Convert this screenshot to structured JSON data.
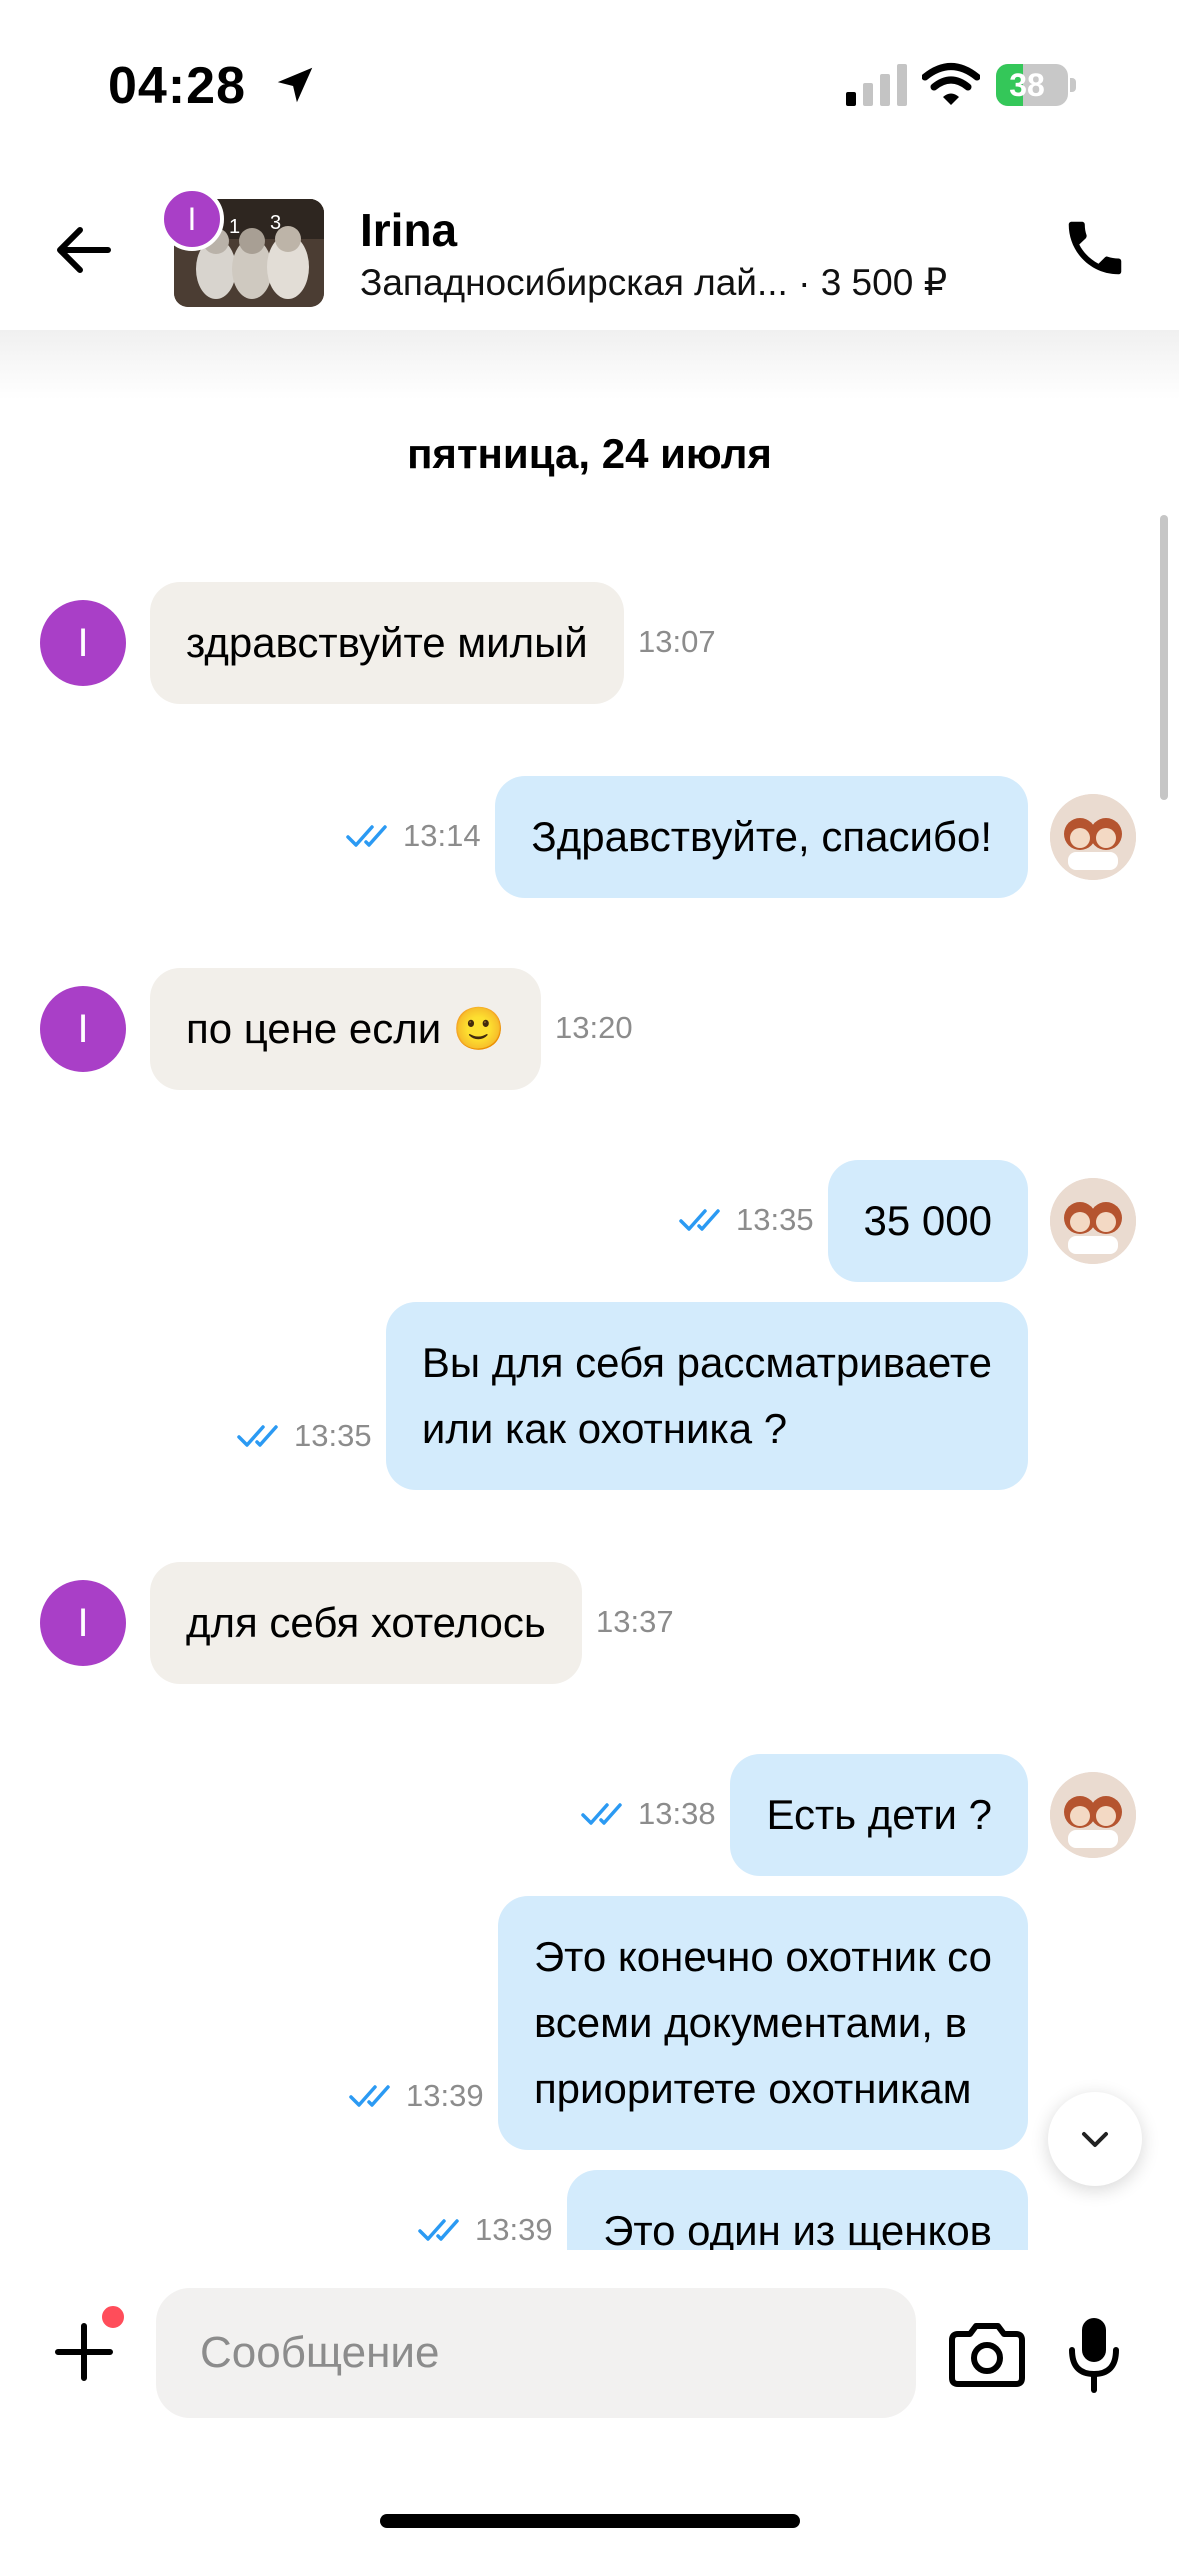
{
  "status_bar": {
    "time": "04:28",
    "battery": "38",
    "battery_level": 0.38,
    "icons": [
      "location-arrow-icon",
      "cellular-signal-icon",
      "wifi-icon",
      "battery-charging-icon"
    ]
  },
  "header": {
    "contact_name": "Irina",
    "avatar_letter": "I",
    "listing_title": "Западносибирская лай...",
    "listing_price": " · 3 500 ₽",
    "icons": [
      "back-arrow-icon",
      "phone-icon"
    ],
    "accent_color": "#a93fc7"
  },
  "chat": {
    "date_separator": "пятница, 24 июля",
    "messages": [
      {
        "direction": "in",
        "text": "здравствуйте милый",
        "time": "13:07"
      },
      {
        "direction": "out",
        "text": "Здравствуйте, спасибо!",
        "time": "13:14"
      },
      {
        "direction": "in",
        "text": "по цене если 🙂",
        "time": "13:20"
      },
      {
        "direction": "out",
        "text": "35 000",
        "time": "13:35"
      },
      {
        "direction": "out",
        "text": "Вы для себя рассматриваете\nили как охотника ?",
        "time": "13:35"
      },
      {
        "direction": "in",
        "text": "для себя хотелось",
        "time": "13:37"
      },
      {
        "direction": "out",
        "text": "Есть дети ?",
        "time": "13:38"
      },
      {
        "direction": "out",
        "text": "Это конечно охотник со\nвсеми документами, в\nприоритете охотникам",
        "time": "13:39"
      },
      {
        "direction": "out",
        "text": "Это один из щенков",
        "time": "13:39"
      }
    ],
    "colors": {
      "incoming_bubble": "#f2efea",
      "outgoing_bubble": "#d3ebfc",
      "read_check": "#2b9af3"
    }
  },
  "composer": {
    "placeholder": "Сообщение",
    "icons": [
      "plus-icon",
      "camera-icon",
      "microphone-icon",
      "chevron-down-icon"
    ]
  }
}
